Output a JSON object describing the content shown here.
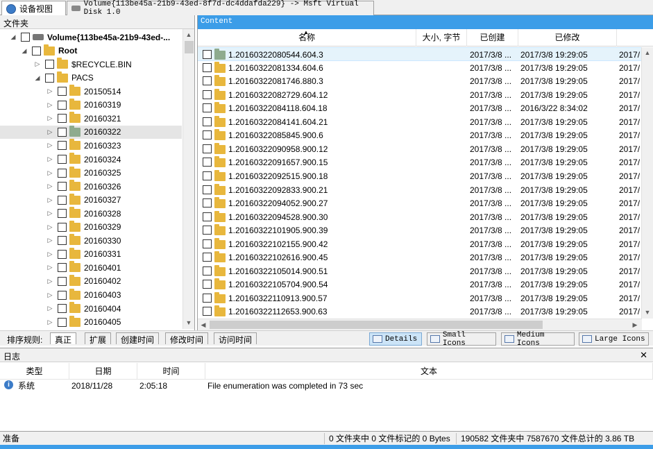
{
  "tabs": [
    {
      "label": "设备视图",
      "icon": "device-view-icon"
    },
    {
      "label": "Volume{113be45a-21b9-43ed-8f7d-dc4ddafda229} -> Msft Virtual Disk 1.0",
      "icon": "disk-icon"
    }
  ],
  "folders": {
    "title": "文件夹",
    "volume_label": "Volume{113be45a-21b9-43ed-...",
    "root_label": "Root",
    "recycle_label": "$RECYCLE.BIN",
    "pacs_label": "PACS",
    "dates": [
      "20150514",
      "20160319",
      "20160321",
      "20160322",
      "20160323",
      "20160324",
      "20160325",
      "20160326",
      "20160327",
      "20160328",
      "20160329",
      "20160330",
      "20160331",
      "20160401",
      "20160402",
      "20160403",
      "20160404",
      "20160405"
    ]
  },
  "content": {
    "title": "Content",
    "columns": {
      "name": "名称",
      "size": "大小, 字节",
      "created": "已创建",
      "modified": "已修改"
    },
    "rows": [
      {
        "name": "1.20160322080544.604.3",
        "created": "2017/3/8 ...",
        "modified": "2017/3/8 19:29:05",
        "extra": "2017/"
      },
      {
        "name": "1.20160322081334.604.6",
        "created": "2017/3/8 ...",
        "modified": "2017/3/8 19:29:05",
        "extra": "2017/"
      },
      {
        "name": "1.20160322081746.880.3",
        "created": "2017/3/8 ...",
        "modified": "2017/3/8 19:29:05",
        "extra": "2017/"
      },
      {
        "name": "1.20160322082729.604.12",
        "created": "2017/3/8 ...",
        "modified": "2017/3/8 19:29:05",
        "extra": "2017/"
      },
      {
        "name": "1.20160322084118.604.18",
        "created": "2017/3/8 ...",
        "modified": "2016/3/22 8:34:02",
        "extra": "2017/"
      },
      {
        "name": "1.20160322084141.604.21",
        "created": "2017/3/8 ...",
        "modified": "2017/3/8 19:29:05",
        "extra": "2017/"
      },
      {
        "name": "1.20160322085845.900.6",
        "created": "2017/3/8 ...",
        "modified": "2017/3/8 19:29:05",
        "extra": "2017/"
      },
      {
        "name": "1.20160322090958.900.12",
        "created": "2017/3/8 ...",
        "modified": "2017/3/8 19:29:05",
        "extra": "2017/"
      },
      {
        "name": "1.20160322091657.900.15",
        "created": "2017/3/8 ...",
        "modified": "2017/3/8 19:29:05",
        "extra": "2017/"
      },
      {
        "name": "1.20160322092515.900.18",
        "created": "2017/3/8 ...",
        "modified": "2017/3/8 19:29:05",
        "extra": "2017/"
      },
      {
        "name": "1.20160322092833.900.21",
        "created": "2017/3/8 ...",
        "modified": "2017/3/8 19:29:05",
        "extra": "2017/"
      },
      {
        "name": "1.20160322094052.900.27",
        "created": "2017/3/8 ...",
        "modified": "2017/3/8 19:29:05",
        "extra": "2017/"
      },
      {
        "name": "1.20160322094528.900.30",
        "created": "2017/3/8 ...",
        "modified": "2017/3/8 19:29:05",
        "extra": "2017/"
      },
      {
        "name": "1.20160322101905.900.39",
        "created": "2017/3/8 ...",
        "modified": "2017/3/8 19:29:05",
        "extra": "2017/"
      },
      {
        "name": "1.20160322102155.900.42",
        "created": "2017/3/8 ...",
        "modified": "2017/3/8 19:29:05",
        "extra": "2017/"
      },
      {
        "name": "1.20160322102616.900.45",
        "created": "2017/3/8 ...",
        "modified": "2017/3/8 19:29:05",
        "extra": "2017/"
      },
      {
        "name": "1.20160322105014.900.51",
        "created": "2017/3/8 ...",
        "modified": "2017/3/8 19:29:05",
        "extra": "2017/"
      },
      {
        "name": "1.20160322105704.900.54",
        "created": "2017/3/8 ...",
        "modified": "2017/3/8 19:29:05",
        "extra": "2017/"
      },
      {
        "name": "1.20160322110913.900.57",
        "created": "2017/3/8 ...",
        "modified": "2017/3/8 19:29:05",
        "extra": "2017/"
      },
      {
        "name": "1.20160322112653.900.63",
        "created": "2017/3/8 ...",
        "modified": "2017/3/8 19:29:05",
        "extra": "2017/"
      }
    ]
  },
  "sort_bar": {
    "label": "排序规则:",
    "items": [
      "真正",
      "扩展",
      "创建时间",
      "修改时间",
      "访问时间"
    ],
    "views": [
      "Details",
      "Small Icons",
      "Medium Icons",
      "Large Icons"
    ]
  },
  "log": {
    "title": "日志",
    "columns": {
      "type": "类型",
      "date": "日期",
      "time": "时间",
      "text": "文本"
    },
    "entry": {
      "type": "系统",
      "date": "2018/11/28",
      "time": "2:05:18",
      "text": "File enumeration was completed in 73 sec"
    }
  },
  "status": {
    "ready": "准备",
    "marked": "0 文件夹中 0 文件标记的 0 Bytes",
    "total": "190582 文件夹中 7587670 文件总计的 3.86 TB"
  }
}
